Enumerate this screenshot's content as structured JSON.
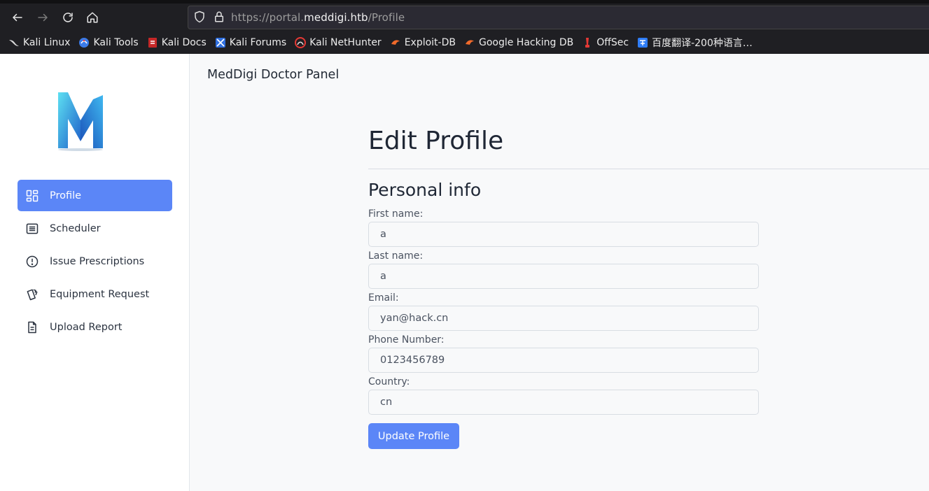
{
  "browser": {
    "url_prefix": "https://portal.",
    "url_domain": "meddigi.htb",
    "url_path": "/Profile",
    "bookmarks": [
      {
        "label": "Kali Linux",
        "icon": "kali-dragon-icon"
      },
      {
        "label": "Kali Tools",
        "icon": "kali-tools-icon"
      },
      {
        "label": "Kali Docs",
        "icon": "kali-docs-icon"
      },
      {
        "label": "Kali Forums",
        "icon": "kali-forums-icon"
      },
      {
        "label": "Kali NetHunter",
        "icon": "nethunter-icon"
      },
      {
        "label": "Exploit-DB",
        "icon": "exploit-db-icon"
      },
      {
        "label": "Google Hacking DB",
        "icon": "ghdb-icon"
      },
      {
        "label": "OffSec",
        "icon": "offsec-icon"
      },
      {
        "label": "百度翻译-200种语言…",
        "icon": "baidu-translate-icon"
      }
    ]
  },
  "sidebar": {
    "items": [
      {
        "label": "Profile",
        "icon": "dashboard-icon",
        "active": true
      },
      {
        "label": "Scheduler",
        "icon": "list-icon"
      },
      {
        "label": "Issue Prescriptions",
        "icon": "alert-circle-icon"
      },
      {
        "label": "Equipment Request",
        "icon": "cards-icon"
      },
      {
        "label": "Upload Report",
        "icon": "file-icon"
      }
    ]
  },
  "header": {
    "title": "MedDigi Doctor Panel"
  },
  "main": {
    "title": "Edit Profile",
    "section": "Personal info",
    "fields": [
      {
        "label": "First name:",
        "value": "a"
      },
      {
        "label": "Last name:",
        "value": "a"
      },
      {
        "label": "Email:",
        "value": "yan@hack.cn"
      },
      {
        "label": "Phone Number:",
        "value": "0123456789"
      },
      {
        "label": "Country:",
        "value": "cn"
      }
    ],
    "submit_label": "Update Profile"
  },
  "colors": {
    "accent": "#5b86f7",
    "chrome": "#1f1f23"
  }
}
